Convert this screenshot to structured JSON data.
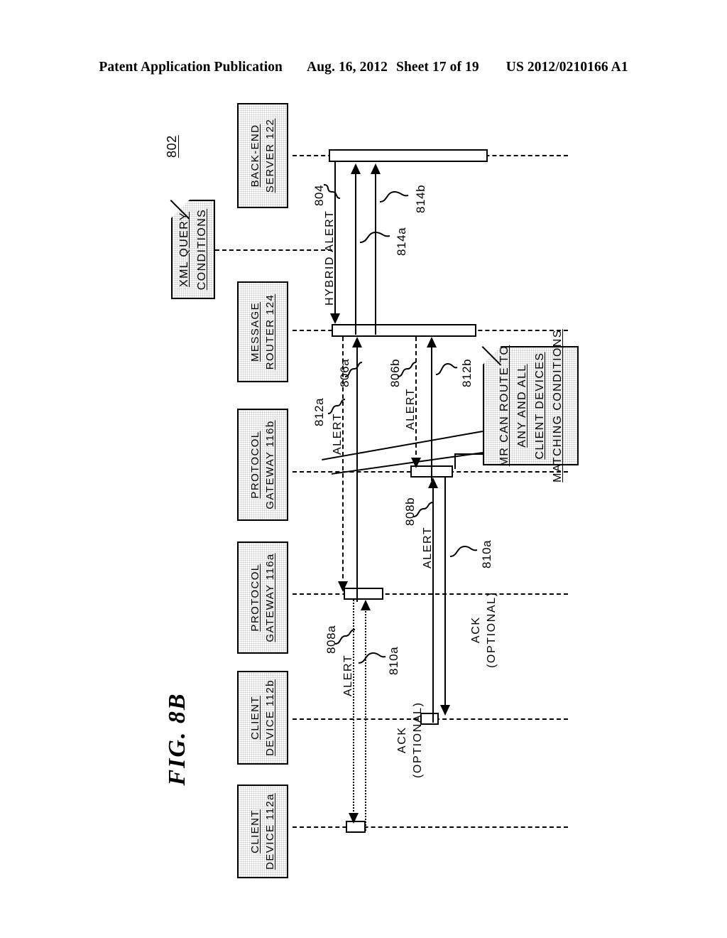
{
  "header": {
    "publication": "Patent Application Publication",
    "date": "Aug. 16, 2012",
    "sheet": "Sheet 17 of 19",
    "patent_number": "US 2012/0210166 A1"
  },
  "figure": {
    "title": "FIG.  8B",
    "diagram_ref": "802"
  },
  "actors": [
    {
      "id": "back-end-server",
      "line1": "BACK-END",
      "line2": "SERVER 122"
    },
    {
      "id": "message-router",
      "line1": "MESSAGE",
      "line2": "ROUTER 124"
    },
    {
      "id": "protocol-gateway-116b",
      "line1": "PROTOCOL",
      "line2": "GATEWAY 116b"
    },
    {
      "id": "protocol-gateway-116a",
      "line1": "PROTOCOL",
      "line2": "GATEWAY 116a"
    },
    {
      "id": "client-device-112b",
      "line1": "CLIENT",
      "line2": "DEVICE 112b"
    },
    {
      "id": "client-device-112a",
      "line1": "CLIENT",
      "line2": "DEVICE 112a"
    }
  ],
  "notes": [
    {
      "id": "xml-query-conditions",
      "lines": [
        "XML QUERY",
        "CONDITIONS"
      ]
    },
    {
      "id": "mr-routing",
      "lines": [
        "MR CAN ROUTE TO",
        "ANY AND ALL",
        "CLIENT DEVICES",
        "MATCHING CONDITIONS"
      ]
    }
  ],
  "messages": [
    {
      "id": "hybrid-alert",
      "label": "HYBRID ALERT",
      "ref": "804"
    },
    {
      "id": "alert-812a",
      "label": "ALERT",
      "ref": "812a"
    },
    {
      "id": "ack-806a",
      "label": "",
      "ref": "806a"
    },
    {
      "id": "alert-806b",
      "label": "ALERT",
      "ref": "806b"
    },
    {
      "id": "ack-812b",
      "label": "",
      "ref": "812b"
    },
    {
      "id": "ack-814a",
      "label": "",
      "ref": "814a"
    },
    {
      "id": "ack-814b",
      "label": "",
      "ref": "814b"
    },
    {
      "id": "alert-808a",
      "label": "ALERT",
      "ref": "808a"
    },
    {
      "id": "ack-810a-lower",
      "label_line1": "ACK",
      "label_line2": "(OPTIONAL)",
      "ref": "810a"
    },
    {
      "id": "alert-808b",
      "label": "ALERT",
      "ref": "808b"
    },
    {
      "id": "ack-810a-upper",
      "label_line1": "ACK",
      "label_line2": "(OPTIONAL)",
      "ref": "810a"
    }
  ],
  "labels": {
    "alert": "ALERT",
    "hybrid_alert": "HYBRID ALERT",
    "ack": "ACK",
    "optional": "(OPTIONAL)",
    "ref_802": "802",
    "ref_804": "804",
    "ref_806a": "806a",
    "ref_806b": "806b",
    "ref_808a": "808a",
    "ref_808b": "808b",
    "ref_810a": "810a",
    "ref_810a2": "810a",
    "ref_812a": "812a",
    "ref_812b": "812b",
    "ref_814a": "814a",
    "ref_814b": "814b"
  }
}
